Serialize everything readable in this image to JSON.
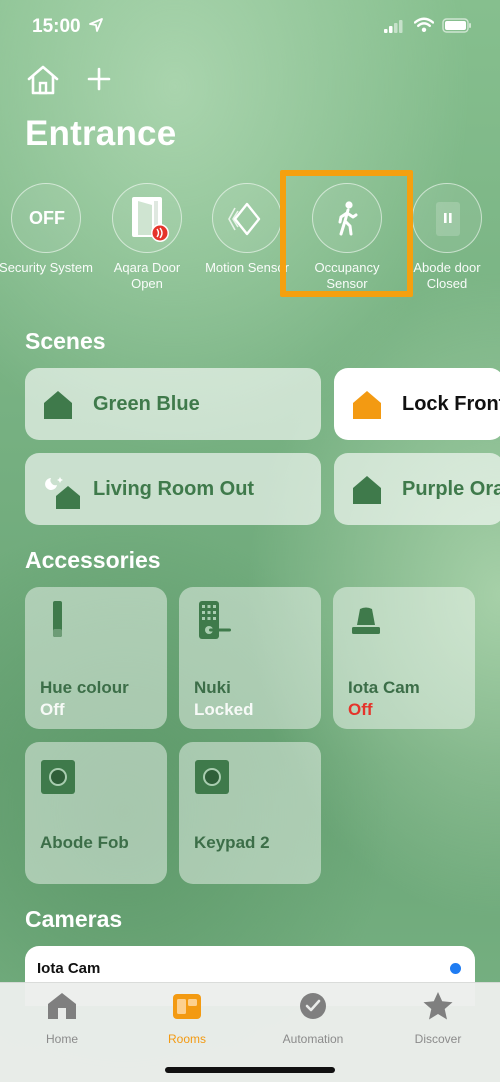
{
  "status_bar": {
    "time": "15:00"
  },
  "page": {
    "title": "Entrance"
  },
  "status_items": [
    {
      "label": "Security System",
      "icon": "off-text-icon",
      "off_text": "OFF"
    },
    {
      "label": "Aqara Door Open",
      "icon": "door-open-icon"
    },
    {
      "label": "Motion Sensor",
      "icon": "motion-sensor-icon"
    },
    {
      "label": "Occupancy Sensor",
      "icon": "person-walking-icon"
    },
    {
      "label": "Abode door Closed",
      "icon": "door-closed-icon"
    }
  ],
  "scenes": {
    "title": "Scenes",
    "items": [
      {
        "label": "Green Blue",
        "icon": "house-icon",
        "active": false
      },
      {
        "label": "Lock Front",
        "icon": "house-icon",
        "active": true,
        "accent": "#f39a12"
      },
      {
        "label": "Living Room Out",
        "icon": "house-moon-icon",
        "active": false
      },
      {
        "label": "Purple Ora",
        "icon": "house-icon",
        "active": false
      }
    ]
  },
  "accessories": {
    "title": "Accessories",
    "items": [
      {
        "name": "Hue colour",
        "status": "Off",
        "icon": "lightstrip-icon"
      },
      {
        "name": "Nuki",
        "status": "Locked",
        "icon": "smart-lock-icon"
      },
      {
        "name": "Iota Cam",
        "status": "Off",
        "icon": "siren-icon",
        "status_color": "#e5342a"
      },
      {
        "name": "Abode Fob",
        "status": "",
        "icon": "sensor-icon"
      },
      {
        "name": "Keypad 2",
        "status": "",
        "icon": "sensor-icon"
      }
    ]
  },
  "cameras": {
    "title": "Cameras",
    "items": [
      {
        "name": "Iota Cam",
        "indicator_color": "#1f7cf2"
      }
    ]
  },
  "tab_bar": {
    "items": [
      {
        "label": "Home",
        "icon": "house-icon",
        "active": false
      },
      {
        "label": "Rooms",
        "icon": "rooms-icon",
        "active": true
      },
      {
        "label": "Automation",
        "icon": "clock-icon",
        "active": false
      },
      {
        "label": "Discover",
        "icon": "star-icon",
        "active": false
      }
    ],
    "accent": "#f39a12"
  },
  "colors": {
    "highlight": "#f5a00f",
    "tile_text_green": "#3f7a4b"
  }
}
